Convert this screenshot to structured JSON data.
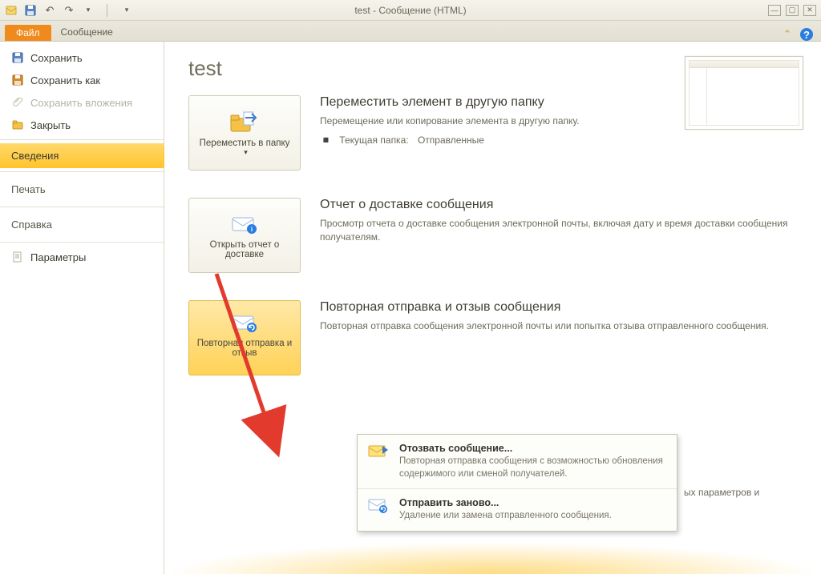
{
  "window": {
    "title": "test  -  Сообщение (HTML)"
  },
  "ribbon": {
    "file_tab": "Файл",
    "message_tab": "Сообщение"
  },
  "sidepanel": {
    "save": "Сохранить",
    "save_as": "Сохранить как",
    "save_attachments": "Сохранить вложения",
    "close": "Закрыть",
    "info_selected": "Сведения",
    "print": "Печать",
    "help": "Справка",
    "options": "Параметры"
  },
  "page": {
    "title": "test"
  },
  "sections": {
    "move": {
      "button": "Переместить в папку",
      "heading": "Переместить элемент в другую папку",
      "text": "Перемещение или копирование элемента в другую папку.",
      "current_label": "Текущая папка:",
      "current_value": "Отправленные"
    },
    "delivery": {
      "button": "Открыть отчет о доставке",
      "heading": "Отчет о доставке сообщения",
      "text": "Просмотр отчета о доставке сообщения электронной почты, включая дату и время доставки сообщения получателям."
    },
    "resend": {
      "button": "Повторная отправка и отзыв",
      "heading": "Повторная отправка и отзыв сообщения",
      "text": "Повторная отправка сообщения электронной почты или попытка отзыва отправленного сообщения."
    }
  },
  "dropdown": {
    "recall": {
      "title": "Отозвать сообщение...",
      "desc": "Повторная отправка сообщения с возможностью обновления содержимого или сменой получателей."
    },
    "resend": {
      "title": "Отправить заново...",
      "desc": "Удаление или замена отправленного сообщения."
    }
  },
  "behind_text": "ых параметров и"
}
